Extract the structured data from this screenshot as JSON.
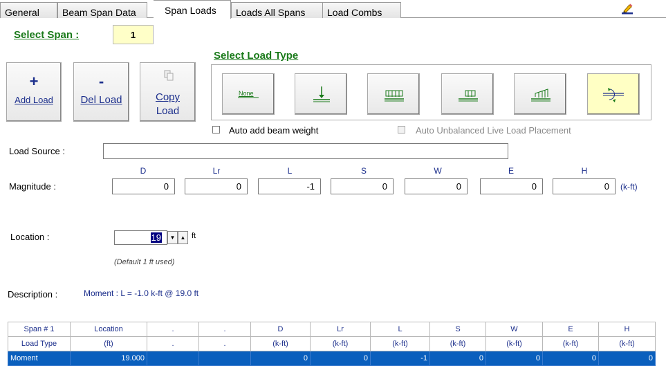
{
  "tabs": [
    "General",
    "Beam Span Data",
    "Span Loads",
    "Loads All Spans",
    "Load Combs"
  ],
  "select_span": {
    "label": "Select Span :",
    "value": "1"
  },
  "buttons": {
    "add": {
      "symbol": "+",
      "label": "Add Load"
    },
    "del": {
      "symbol": "-",
      "label": "Del Load"
    },
    "copy": {
      "label_1": "Copy",
      "label_2": "Load"
    }
  },
  "load_type": {
    "title": "Select Load Type",
    "none_label": "None",
    "selected": "moment"
  },
  "checkboxes": {
    "auto_weight": {
      "label": "Auto add beam weight",
      "checked": false
    },
    "auto_unbalanced": {
      "label": "Auto Unbalanced Live Load Placement",
      "checked": false,
      "enabled": false
    }
  },
  "load_source": {
    "label": "Load Source :",
    "value": ""
  },
  "magnitude": {
    "label": "Magnitude :",
    "unit": "(k-ft)",
    "cases": [
      {
        "name": "D",
        "value": "0"
      },
      {
        "name": "Lr",
        "value": "0"
      },
      {
        "name": "L",
        "value": "-1"
      },
      {
        "name": "S",
        "value": "0"
      },
      {
        "name": "W",
        "value": "0"
      },
      {
        "name": "E",
        "value": "0"
      },
      {
        "name": "H",
        "value": "0"
      }
    ]
  },
  "location": {
    "label": "Location :",
    "value": "19",
    "unit": "ft",
    "note": "(Default 1 ft used)"
  },
  "description": {
    "label": "Description :",
    "value": "Moment :  L = -1.0 k-ft @ 19.0 ft"
  },
  "table": {
    "header1": [
      "Span # 1",
      "Location",
      ".",
      ".",
      "D",
      "Lr",
      "L",
      "S",
      "W",
      "E",
      "H"
    ],
    "header2": [
      "Load Type",
      "(ft)",
      ".",
      ".",
      "(k-ft)",
      "(k-ft)",
      "(k-ft)",
      "(k-ft)",
      "(k-ft)",
      "(k-ft)",
      "(k-ft)"
    ],
    "rows": [
      [
        "Moment",
        "19.000",
        "",
        "",
        "0",
        "0",
        "-1",
        "0",
        "0",
        "0",
        "0"
      ]
    ]
  }
}
